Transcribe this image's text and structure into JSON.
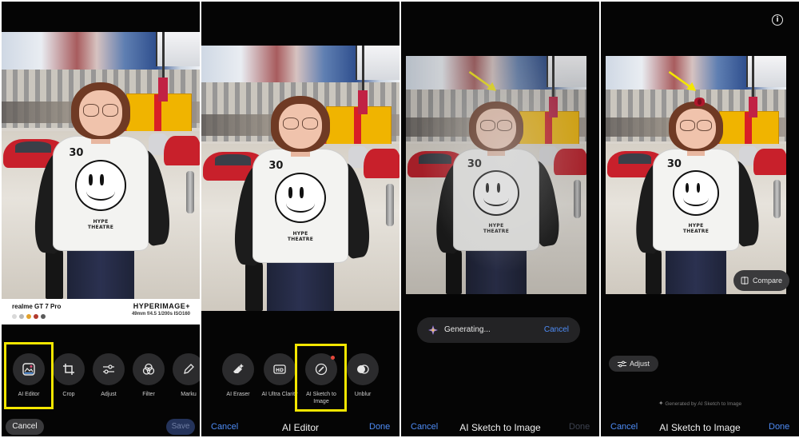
{
  "colors": {
    "accent_blue": "#4e8cf6",
    "highlight_yellow": "#f3e600",
    "panel_bg": "#050505"
  },
  "panel1": {
    "watermark": {
      "model": "realme GT 7 Pro",
      "brand": "HYPERIMAGE+",
      "params": "49mm f/4.5 1/200s ISO160",
      "swatches": [
        "#d9d9d9",
        "#b7b7b7",
        "#e2a12b",
        "#b23a2e",
        "#5a5a5a"
      ]
    },
    "tools": [
      {
        "label": "AI Editor",
        "icon": "ai-editor-icon"
      },
      {
        "label": "Crop",
        "icon": "crop-icon"
      },
      {
        "label": "Adjust",
        "icon": "sliders-icon"
      },
      {
        "label": "Filter",
        "icon": "filter-icon"
      },
      {
        "label": "Marku",
        "icon": "pen-icon"
      }
    ],
    "cancel": "Cancel",
    "save": "Save"
  },
  "panel2": {
    "tools": [
      {
        "label": "AI Eraser",
        "icon": "eraser-icon"
      },
      {
        "label": "AI Ultra Clarity",
        "icon": "hd-icon"
      },
      {
        "label": "AI Sketch to Image",
        "icon": "sketch-icon"
      },
      {
        "label": "Unblur",
        "icon": "unblur-icon"
      }
    ],
    "cancel": "Cancel",
    "title": "AI Editor",
    "done": "Done"
  },
  "panel3": {
    "generating": "Generating...",
    "gen_cancel": "Cancel",
    "cancel": "Cancel",
    "title": "AI Sketch to Image",
    "done": "Done"
  },
  "panel4": {
    "info": "i",
    "compare": "Compare",
    "adjust": "Adjust",
    "note": "Generated by AI Sketch to Image",
    "cancel": "Cancel",
    "title": "AI Sketch to Image",
    "done": "Done"
  }
}
